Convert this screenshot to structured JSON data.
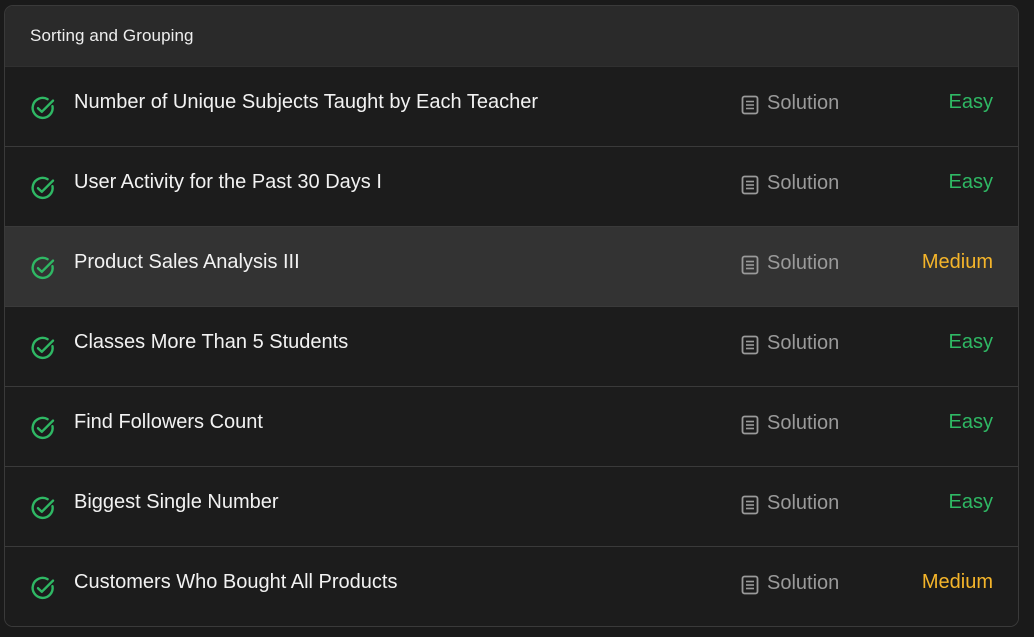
{
  "section": {
    "title": "Sorting and Grouping"
  },
  "colors": {
    "easy": "#2fb864",
    "medium": "#f5b52a",
    "check": "#2fb864"
  },
  "problems": [
    {
      "title": "Number of Unique Subjects Taught by Each Teacher",
      "solution_label": "Solution",
      "difficulty": "Easy",
      "level": "easy",
      "solved": true,
      "status_icon": "check-circle-icon",
      "solution_icon": "document-icon"
    },
    {
      "title": "User Activity for the Past 30 Days I",
      "solution_label": "Solution",
      "difficulty": "Easy",
      "level": "easy",
      "solved": true,
      "status_icon": "check-circle-icon",
      "solution_icon": "document-icon"
    },
    {
      "title": "Product Sales Analysis III",
      "solution_label": "Solution",
      "difficulty": "Medium",
      "level": "medium",
      "solved": true,
      "status_icon": "check-circle-icon",
      "solution_icon": "document-icon"
    },
    {
      "title": "Classes More Than 5 Students",
      "solution_label": "Solution",
      "difficulty": "Easy",
      "level": "easy",
      "solved": true,
      "status_icon": "check-circle-icon",
      "solution_icon": "document-icon"
    },
    {
      "title": "Find Followers Count",
      "solution_label": "Solution",
      "difficulty": "Easy",
      "level": "easy",
      "solved": true,
      "status_icon": "check-circle-icon",
      "solution_icon": "document-icon"
    },
    {
      "title": "Biggest Single Number",
      "solution_label": "Solution",
      "difficulty": "Easy",
      "level": "easy",
      "solved": true,
      "status_icon": "check-circle-icon",
      "solution_icon": "document-icon"
    },
    {
      "title": "Customers Who Bought All Products",
      "solution_label": "Solution",
      "difficulty": "Medium",
      "level": "medium",
      "solved": true,
      "status_icon": "check-circle-icon",
      "solution_icon": "document-icon"
    }
  ]
}
